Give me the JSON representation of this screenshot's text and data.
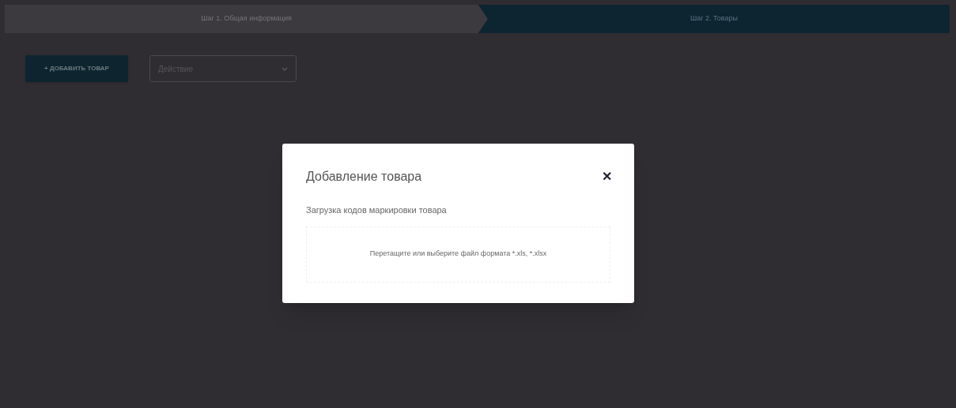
{
  "steps": [
    {
      "label": "Шаг 1. Общая информация",
      "selected": false
    },
    {
      "label": "Шаг 2. Товары",
      "selected": true
    }
  ],
  "toolbar": {
    "add_button": "+  ДОБАВИТЬ ТОВАР",
    "action_select": {
      "placeholder": "Действие"
    }
  },
  "modal": {
    "title": "Добавление товара",
    "close": "✕",
    "subtitle": "Загрузка кодов маркировки товара",
    "dropzone": "Перетащите или выберите файл формата *.xls, *.xlsx"
  }
}
